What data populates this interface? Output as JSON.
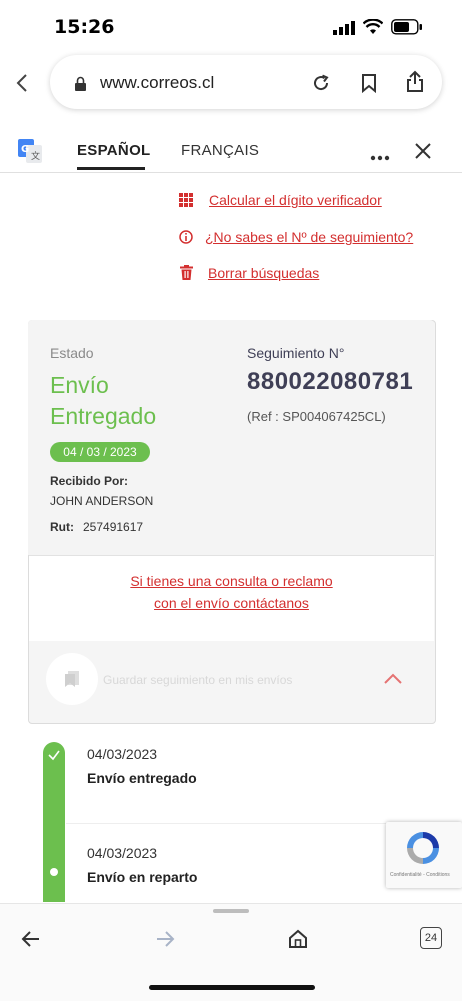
{
  "status_bar": {
    "time": "15:26"
  },
  "browser": {
    "url": "www.correos.cl"
  },
  "translate_bar": {
    "tab_es": "ESPAÑOL",
    "tab_fr": "FRANÇAIS"
  },
  "links": {
    "calc": "Calcular el dígito verificador",
    "no_sabes": "¿No sabes el Nº de seguimiento?",
    "borrar": "Borrar búsquedas"
  },
  "card": {
    "estado_label": "Estado",
    "estado_line1": "Envío",
    "estado_line2": "Entregado",
    "seguimiento_label": "Seguimiento N°",
    "tracking_number": "880022080781",
    "ref": "(Ref : SP004067425CL)",
    "date_badge": "04 / 03 / 2023",
    "recibido_label": "Recibido Por:",
    "recibido_name": "JOHN ANDERSON",
    "rut_label": "Rut:",
    "rut_value": "257491617",
    "contact_line1": "Si tienes una consulta o reclamo",
    "contact_line2": "con el envío contáctanos",
    "save_text": "Guardar seguimiento en mis envíos"
  },
  "timeline": [
    {
      "date": "04/03/2023",
      "event": "Envío entregado"
    },
    {
      "date": "04/03/2023",
      "event": "Envío en reparto"
    }
  ],
  "recaptcha": {
    "text": "Confidentialité - Conditions"
  },
  "toolbar": {
    "tabs_count": "24"
  },
  "colors": {
    "accent_red": "#d32f2f",
    "success_green": "#6cbf4e",
    "dark_navy": "#3f3f56"
  }
}
